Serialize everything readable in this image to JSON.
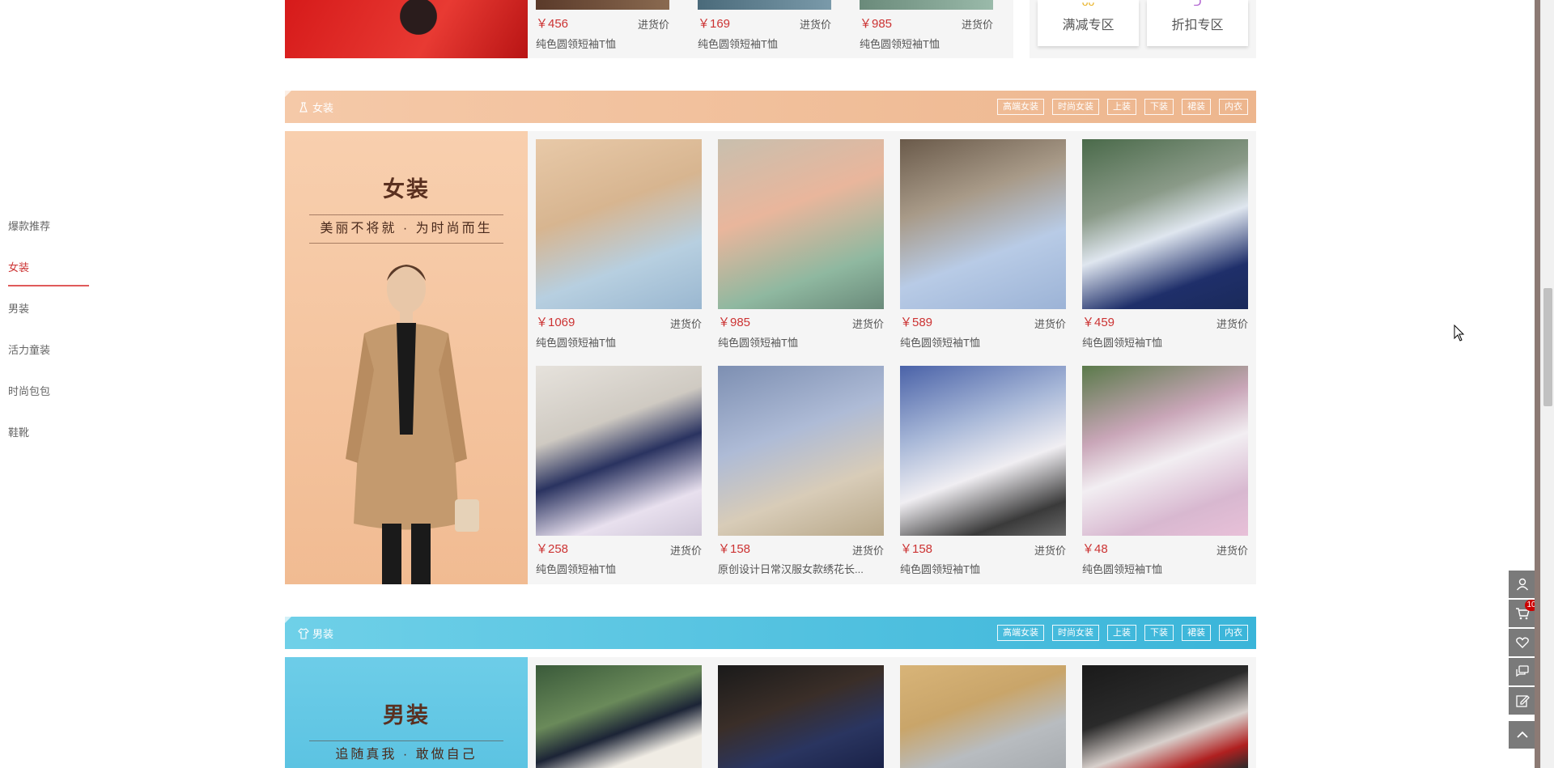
{
  "side_nav": {
    "items": [
      {
        "label": "爆款推荐",
        "active": false
      },
      {
        "label": "女装",
        "active": true
      },
      {
        "label": "男装",
        "active": false
      },
      {
        "label": "活力童装",
        "active": false
      },
      {
        "label": "时尚包包",
        "active": false
      },
      {
        "label": "鞋靴",
        "active": false
      }
    ]
  },
  "top_strip": {
    "goods": [
      {
        "price": "￥456",
        "tag": "进货价",
        "name": "纯色圆领短袖T恤"
      },
      {
        "price": "￥169",
        "tag": "进货价",
        "name": "纯色圆领短袖T恤"
      },
      {
        "price": "￥985",
        "tag": "进货价",
        "name": "纯色圆领短袖T恤"
      }
    ],
    "zones": [
      {
        "label": "满减专区",
        "icon": "discount-icon",
        "color": "#e8b020"
      },
      {
        "label": "折扣专区",
        "icon": "sale-icon",
        "color": "#b060d0"
      }
    ]
  },
  "floors": [
    {
      "title": "女装",
      "icon": "dress-icon",
      "tags": [
        "高端女装",
        "时尚女装",
        "上装",
        "下装",
        "裙装",
        "内衣"
      ],
      "banner": {
        "title": "女装",
        "subtitle": "美丽不将就 · 为时尚而生"
      },
      "goods": [
        {
          "price": "￥1069",
          "tag": "进货价",
          "name": "纯色圆领短袖T恤"
        },
        {
          "price": "￥985",
          "tag": "进货价",
          "name": "纯色圆领短袖T恤"
        },
        {
          "price": "￥589",
          "tag": "进货价",
          "name": "纯色圆领短袖T恤"
        },
        {
          "price": "￥459",
          "tag": "进货价",
          "name": "纯色圆领短袖T恤"
        },
        {
          "price": "￥258",
          "tag": "进货价",
          "name": "纯色圆领短袖T恤"
        },
        {
          "price": "￥158",
          "tag": "进货价",
          "name": "原创设计日常汉服女款绣花长..."
        },
        {
          "price": "￥158",
          "tag": "进货价",
          "name": "纯色圆领短袖T恤"
        },
        {
          "price": "￥48",
          "tag": "进货价",
          "name": "纯色圆领短袖T恤"
        }
      ]
    },
    {
      "title": "男装",
      "icon": "shirt-icon",
      "tags": [
        "高端女装",
        "时尚女装",
        "上装",
        "下装",
        "裙装",
        "内衣"
      ],
      "banner": {
        "title": "男装",
        "subtitle": "追随真我 · 敢做自己"
      }
    }
  ],
  "right_bar": {
    "cart_count": "10",
    "buttons": [
      "user-icon",
      "cart-icon",
      "heart-icon",
      "chat-icon",
      "edit-icon",
      "back-to-top-icon"
    ]
  }
}
